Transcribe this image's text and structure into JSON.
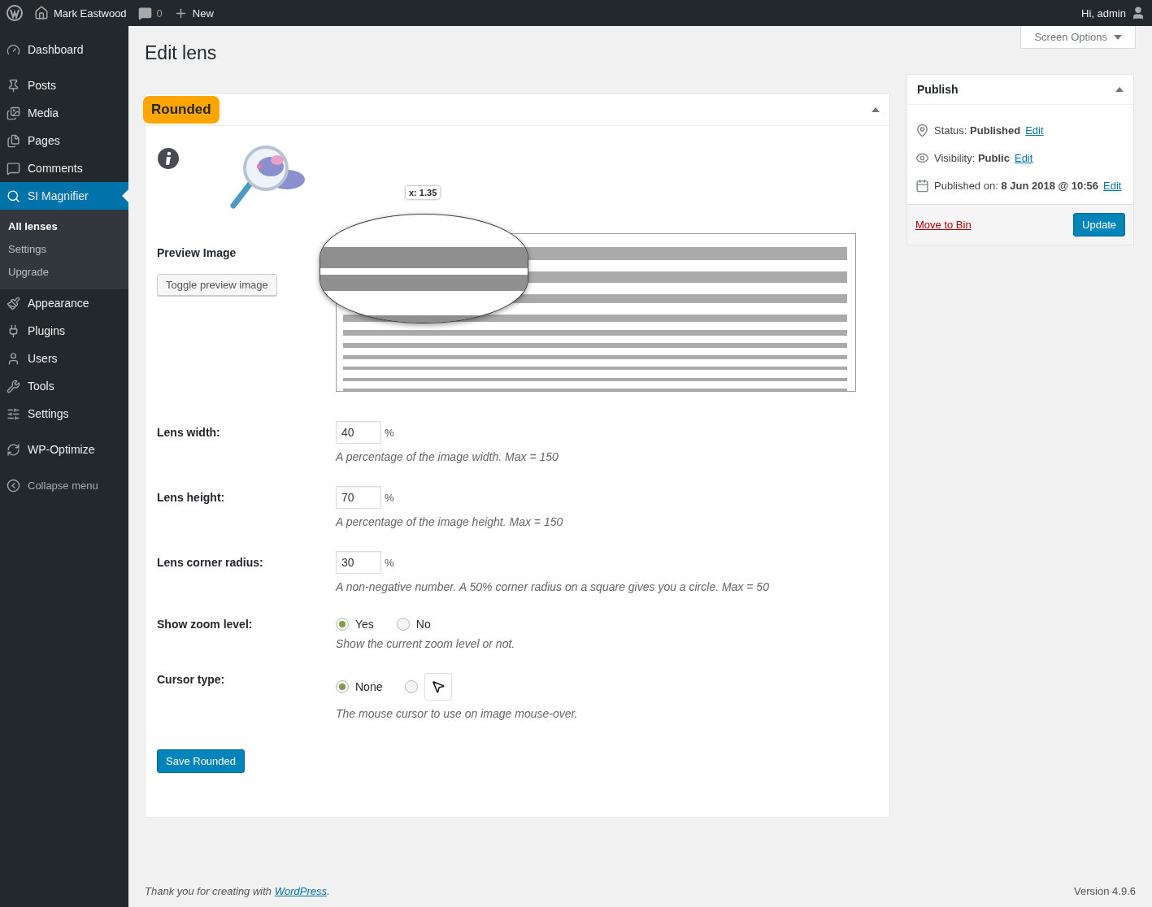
{
  "admin_bar": {
    "site_name": "Mark Eastwood",
    "comments_count": "0",
    "new_label": "New",
    "greeting": "Hi, admin"
  },
  "sidebar": {
    "groups": [
      [
        {
          "label": "Dashboard",
          "selected": false
        }
      ],
      [
        {
          "label": "Posts",
          "selected": false
        },
        {
          "label": "Media",
          "selected": false
        },
        {
          "label": "Pages",
          "selected": false
        },
        {
          "label": "Comments",
          "selected": false
        },
        {
          "label": "SI Magnifier",
          "selected": true,
          "children": [
            {
              "label": "All lenses",
              "selected": true
            },
            {
              "label": "Settings",
              "selected": false
            },
            {
              "label": "Upgrade",
              "selected": false
            }
          ]
        },
        {
          "label": "Appearance",
          "selected": false
        },
        {
          "label": "Plugins",
          "selected": false
        },
        {
          "label": "Users",
          "selected": false
        },
        {
          "label": "Tools",
          "selected": false
        },
        {
          "label": "Settings",
          "selected": false
        }
      ],
      [
        {
          "label": "WP-Optimize",
          "selected": false
        }
      ]
    ],
    "collapse_label": "Collapse menu"
  },
  "screen_options": "Screen Options",
  "page_title": "Edit lens",
  "lens_box": {
    "title": "Rounded",
    "expanded": true,
    "preview": {
      "label": "Preview Image",
      "toggle_button": "Toggle preview image",
      "zoom_label": "x: 1.35"
    },
    "fields": [
      {
        "kind": "number",
        "label": "Lens width:",
        "value": "40",
        "unit": "%",
        "hint": "A percentage of the image width. Max = 150"
      },
      {
        "kind": "number",
        "label": "Lens height:",
        "value": "70",
        "unit": "%",
        "hint": "A percentage of the image height. Max = 150"
      },
      {
        "kind": "number",
        "label": "Lens corner radius:",
        "value": "30",
        "unit": "%",
        "hint": "A non-negative number. A 50% corner radius on a square gives you a circle. Max = 50"
      },
      {
        "kind": "radio",
        "label": "Show zoom level:",
        "options": [
          {
            "label": "Yes",
            "selected": true
          },
          {
            "label": "No",
            "selected": false
          }
        ],
        "hint": "Show the current zoom level or not."
      },
      {
        "kind": "radio",
        "label": "Cursor type:",
        "options": [
          {
            "label": "None",
            "selected": true
          },
          {
            "kind": "cursor",
            "selected": false
          }
        ],
        "hint": "The mouse cursor to use on image mouse-over."
      }
    ],
    "save_button": "Save Rounded"
  },
  "publish": {
    "title": "Publish",
    "expanded": true,
    "rows": [
      {
        "text": "Status: **Published**",
        "link": "Edit"
      },
      {
        "text": "Visibility: **Public**",
        "link": "Edit"
      },
      {
        "text": "Published on: **8 Jun 2018 @ 10:56**",
        "link": "Edit"
      }
    ],
    "trash_link": "Move to Bin",
    "update_button": "Update"
  },
  "footer": {
    "credit_prefix": "Thank you for creating with ",
    "credit_link": "WordPress",
    "credit_suffix": ".",
    "version": "Version 4.9.6"
  }
}
